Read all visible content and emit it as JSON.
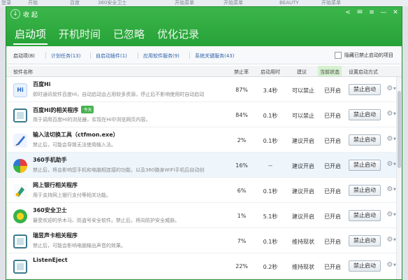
{
  "header": {
    "collapse_label": "收 起",
    "controls": [
      "<",
      "✉",
      "≡",
      "—",
      "✕"
    ]
  },
  "tabs": [
    {
      "label": "启动项",
      "active": true
    },
    {
      "label": "开机时间",
      "active": false
    },
    {
      "label": "已忽略",
      "active": false
    },
    {
      "label": "优化记录",
      "active": false
    }
  ],
  "subtabs": [
    {
      "label": "启动项(8)",
      "active": true
    },
    {
      "label": "计划任务(13)",
      "active": false
    },
    {
      "label": "自启动插件(1)",
      "active": false
    },
    {
      "label": "应用软件服务(9)",
      "active": false
    },
    {
      "label": "系统关键服务(43)",
      "active": false
    }
  ],
  "hide_option": "隐藏已禁止启动的项目",
  "columns": {
    "name": "软件名称",
    "rate": "禁止率",
    "time": "启动用时",
    "advice": "建议",
    "state": "当前状态",
    "action": "设置启动方式"
  },
  "rows": [
    {
      "name": "百度Hi",
      "badge": "",
      "desc": "即时通讯软件百度Hi，自动启动会占用较多资源，停止后不影响使用时自动启动",
      "rate": "87%",
      "time": "3.4秒",
      "advice": "可以禁止",
      "state": "已开启",
      "action": "禁止启动",
      "icon": "baidu-hi-icon"
    },
    {
      "name": "百度Hi的相关程序",
      "badge": "今天",
      "desc": "用于调用百度Hi的浏览器，实现在Hi中浏览网页内容。",
      "rate": "84%",
      "time": "0.1秒",
      "advice": "可以禁止",
      "state": "已开启",
      "action": "禁止启动",
      "icon": "window-icon"
    },
    {
      "name": "输入法切换工具（ctfmon.exe）",
      "badge": "",
      "desc": "禁止后，可能会导致无法使用输入法。",
      "rate": "2%",
      "time": "0.1秒",
      "advice": "建议开启",
      "state": "已开启",
      "action": "禁止启动",
      "icon": "pen-icon"
    },
    {
      "name": "360手机助手",
      "badge": "",
      "desc": "禁止后，将会影响您手机和电脑相连接的功能，以及360随身WIFI手机后自动创",
      "rate": "16%",
      "time": "--",
      "advice": "建议开启",
      "state": "已开启",
      "action": "禁止启动",
      "icon": "360-assistant-icon"
    },
    {
      "name": "网上银行相关程序",
      "badge": "",
      "desc": "用于支持网上银行支付等相关功能。",
      "rate": "6%",
      "time": "0.1秒",
      "advice": "建议开启",
      "state": "已开启",
      "action": "禁止启动",
      "icon": "bank-icon"
    },
    {
      "name": "360安全卫士",
      "badge": "",
      "desc": "最受欢迎的杀木马、防盗号安全软件。禁止后，将向防护安全威胁。",
      "rate": "1%",
      "time": "5.1秒",
      "advice": "建议开启",
      "state": "已开启",
      "action": "禁止启动",
      "icon": "360-safe-icon"
    },
    {
      "name": "瑞昱声卡相关程序",
      "badge": "",
      "desc": "禁止后，可能会影响电脑输出声音的效果。",
      "rate": "7%",
      "time": "0.1秒",
      "advice": "维持现状",
      "state": "已开启",
      "action": "禁止启动",
      "icon": "sound-card-icon"
    },
    {
      "name": "ListenEject",
      "badge": "",
      "desc": "",
      "rate": "22%",
      "time": "0.2秒",
      "advice": "维持现状",
      "state": "已开启",
      "action": "禁止启动",
      "icon": "window-icon"
    }
  ],
  "background_strip": [
    "登录",
    "开始",
    "百度",
    "360安全卫士",
    "开始菜单",
    "开始菜单",
    "BEAUTY",
    "开始菜单"
  ]
}
